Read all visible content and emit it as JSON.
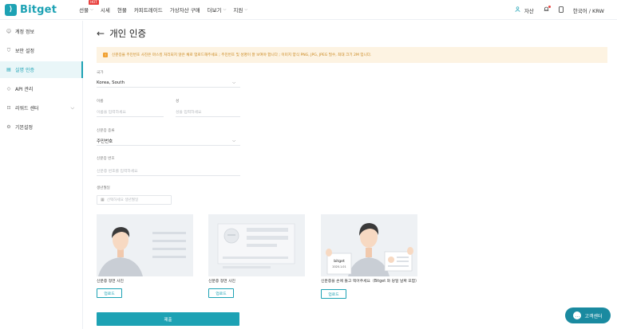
{
  "header": {
    "logo_text": "Bitget",
    "nav": [
      {
        "label": "선물",
        "chevron": true,
        "badge": "HOT"
      },
      {
        "label": "시세",
        "chevron": false
      },
      {
        "label": "현물",
        "chevron": false
      },
      {
        "label": "카피트레이드",
        "chevron": false
      },
      {
        "label": "가상자산 구매",
        "chevron": false
      },
      {
        "label": "더보기",
        "chevron": true
      },
      {
        "label": "지원",
        "chevron": true
      }
    ],
    "assets_label": "자산",
    "language_label": "한국어 / KRW"
  },
  "sidebar": {
    "items": [
      {
        "label": "계정 정보",
        "icon": "user-icon"
      },
      {
        "label": "보안 설정",
        "icon": "shield-icon"
      },
      {
        "label": "실명 인증",
        "icon": "id-card-icon",
        "active": true
      },
      {
        "label": "API 관리",
        "icon": "api-icon"
      },
      {
        "label": "리워드 센터",
        "icon": "gift-icon",
        "chevron": true
      },
      {
        "label": "기본설정",
        "icon": "gear-icon"
      }
    ]
  },
  "main": {
    "title": "개인 인증",
    "notice": "신분증을 주민번호 사진은 마스킹 처리되지 않은 채로 업로드해주세요 ; 주민번호 및 성명이 잘 보여야 합니다 ; 이미지 양식 PNG, JPG, JPEG 필수, 최대 크기 2M 입니다.",
    "country": {
      "label": "국가",
      "value": "Korea, South"
    },
    "name": {
      "label": "이름",
      "placeholder": "이름을 입력하세요"
    },
    "surname": {
      "label": "성",
      "placeholder": "성을 입력하세요"
    },
    "id_type": {
      "label": "신분증 종류",
      "value": "주민번호"
    },
    "id_number": {
      "label": "신분증 번호",
      "placeholder": "신분증 번호를 입력하세요"
    },
    "birth": {
      "label": "생년월일",
      "placeholder": "선택하세요 생년월일"
    },
    "cards": [
      {
        "caption": "신분증 정면 사진",
        "upload": "업로드"
      },
      {
        "caption": "신분증 정면 사진",
        "upload": "업로드"
      },
      {
        "caption": "신분증을 손에 들고 찍어주세요（Bitget 와 당일 날짜 포함）",
        "upload": "업로드",
        "sign_text": "bitget",
        "sign_date": "2020.1.01"
      }
    ],
    "submit_label": "제출"
  },
  "support": {
    "label": "고객센터"
  },
  "colors": {
    "accent": "#1da2b4",
    "notice_bg": "#fdf3e2",
    "notice_text": "#c9861c"
  }
}
